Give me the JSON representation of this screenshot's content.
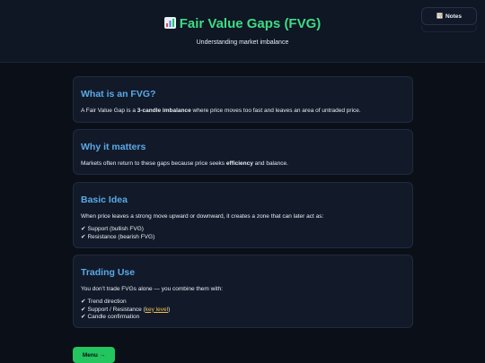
{
  "header": {
    "icon": "bar-chart-icon",
    "title": "Fair Value Gaps (FVG)",
    "subtitle": "Understanding market imbalance"
  },
  "notes_button": {
    "icon": "memo-icon",
    "label": "Notes"
  },
  "cards": {
    "what": {
      "title": "What is an FVG?",
      "text_before": "A Fair Value Gap is a ",
      "bold": "3-candle imbalance",
      "text_after": " where price moves too fast and leaves an area of untraded price."
    },
    "why": {
      "title": "Why it matters",
      "text_before": "Markets often return to these gaps because price seeks ",
      "bold": "efficiency",
      "text_after": " and balance."
    },
    "basic": {
      "title": "Basic Idea",
      "text": "When price leaves a strong move upward or downward, it creates a zone that can later act as:",
      "items": [
        "Support (bullish FVG)",
        "Resistance (bearish FVG)"
      ]
    },
    "trading": {
      "title": "Trading Use",
      "text": "You don’t trade FVGs alone — you combine them with:",
      "items": [
        "Trend direction",
        "Support / Resistance (",
        "Candle confirmation"
      ],
      "key_level": "key level",
      "close_paren": ")"
    }
  },
  "check_mark": "✔",
  "menu_button": {
    "label": "Menu →"
  },
  "colors": {
    "accent_green": "#3ddc84",
    "heading_blue": "#5aa9e6",
    "link_gold": "#f0c14b",
    "background": "#0b0f17"
  }
}
